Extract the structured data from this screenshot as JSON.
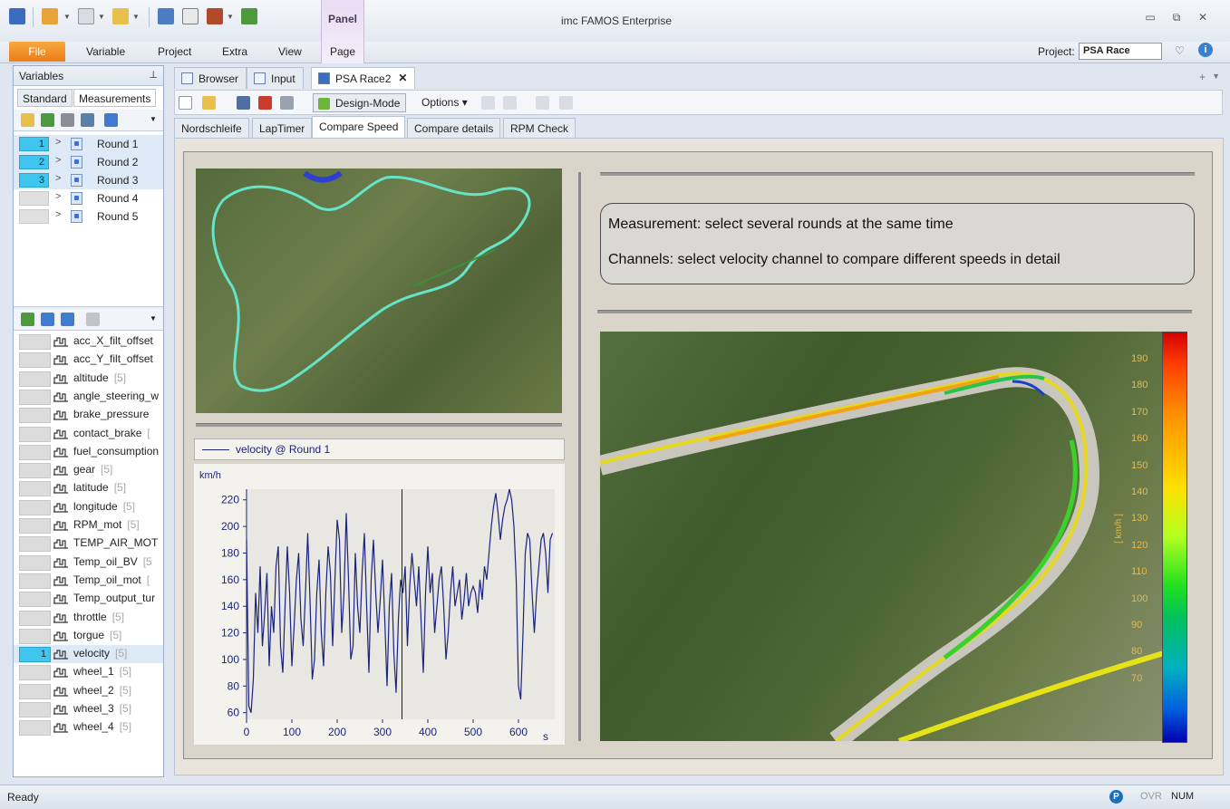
{
  "window": {
    "title": "imc FAMOS Enterprise",
    "context_tab": "Panel"
  },
  "menu": {
    "file": "File",
    "items": [
      "Variable",
      "Project",
      "Extra",
      "View",
      "Page"
    ]
  },
  "project": {
    "label": "Project:",
    "value": "PSA Race"
  },
  "left_pane": {
    "title": "Variables",
    "tabs": [
      "Standard",
      "Measurements"
    ],
    "active_tab": "Measurements",
    "rounds": [
      {
        "index": "1",
        "label": "Round 1",
        "selected": true
      },
      {
        "index": "2",
        "label": "Round 2",
        "selected": true
      },
      {
        "index": "3",
        "label": "Round 3",
        "selected": true
      },
      {
        "index": "",
        "label": "Round 4",
        "selected": false
      },
      {
        "index": "",
        "label": "Round 5",
        "selected": false
      }
    ],
    "channels": [
      {
        "index": "",
        "name": "acc_X_filt_offset",
        "count": ""
      },
      {
        "index": "",
        "name": "acc_Y_filt_offset",
        "count": ""
      },
      {
        "index": "",
        "name": "altitude",
        "count": "[5]"
      },
      {
        "index": "",
        "name": "angle_steering_w",
        "count": ""
      },
      {
        "index": "",
        "name": "brake_pressure",
        "count": ""
      },
      {
        "index": "",
        "name": "contact_brake",
        "count": "["
      },
      {
        "index": "",
        "name": "fuel_consumption",
        "count": ""
      },
      {
        "index": "",
        "name": "gear",
        "count": "[5]"
      },
      {
        "index": "",
        "name": "latitude",
        "count": "[5]"
      },
      {
        "index": "",
        "name": "longitude",
        "count": "[5]"
      },
      {
        "index": "",
        "name": "RPM_mot",
        "count": "[5]"
      },
      {
        "index": "",
        "name": "TEMP_AIR_MOT",
        "count": ""
      },
      {
        "index": "",
        "name": "Temp_oil_BV",
        "count": "[5"
      },
      {
        "index": "",
        "name": "Temp_oil_mot",
        "count": "["
      },
      {
        "index": "",
        "name": "Temp_output_tur",
        "count": ""
      },
      {
        "index": "",
        "name": "throttle",
        "count": "[5]"
      },
      {
        "index": "",
        "name": "torgue",
        "count": "[5]"
      },
      {
        "index": "1",
        "name": "velocity",
        "count": "[5]"
      },
      {
        "index": "",
        "name": "wheel_1",
        "count": "[5]"
      },
      {
        "index": "",
        "name": "wheel_2",
        "count": "[5]"
      },
      {
        "index": "",
        "name": "wheel_3",
        "count": "[5]"
      },
      {
        "index": "",
        "name": "wheel_4",
        "count": "[5]"
      }
    ]
  },
  "doc_tabs": [
    "Browser",
    "Input",
    "PSA Race2"
  ],
  "doc_active": "PSA Race2",
  "toolbar": {
    "design_mode": "Design-Mode",
    "options": "Options"
  },
  "page_tabs": [
    "Nordschleife",
    "LapTimer",
    "Compare Speed",
    "Compare details",
    "RPM Check"
  ],
  "page_active": "Compare Speed",
  "info": {
    "line1": "Measurement: select several rounds at the same time",
    "line2": "Channels: select velocity channel to compare different speeds in detail"
  },
  "chart_data": {
    "type": "line",
    "legend": "velocity @ Round 1",
    "ylabel": "km/h",
    "xlabel": "s",
    "xlim": [
      0,
      680
    ],
    "ylim": [
      55,
      228
    ],
    "xticks": [
      0,
      100,
      200,
      300,
      400,
      500,
      600
    ],
    "yticks": [
      60,
      80,
      100,
      120,
      140,
      160,
      180,
      200,
      220
    ],
    "cursor_x": 343,
    "series": [
      {
        "name": "velocity @ Round 1",
        "x": [
          0,
          5,
          10,
          15,
          20,
          25,
          30,
          35,
          40,
          45,
          50,
          55,
          60,
          65,
          70,
          75,
          80,
          85,
          90,
          95,
          100,
          105,
          110,
          115,
          120,
          125,
          130,
          135,
          140,
          145,
          150,
          155,
          160,
          165,
          170,
          175,
          180,
          185,
          190,
          195,
          200,
          205,
          210,
          215,
          220,
          225,
          230,
          235,
          240,
          245,
          250,
          255,
          260,
          265,
          270,
          275,
          280,
          285,
          290,
          295,
          300,
          305,
          310,
          315,
          320,
          325,
          330,
          335,
          340,
          345,
          350,
          355,
          360,
          365,
          370,
          375,
          380,
          385,
          390,
          395,
          400,
          405,
          410,
          415,
          420,
          425,
          430,
          435,
          440,
          445,
          450,
          455,
          460,
          465,
          470,
          475,
          480,
          485,
          490,
          495,
          500,
          505,
          510,
          515,
          520,
          525,
          530,
          535,
          540,
          545,
          550,
          555,
          560,
          565,
          570,
          575,
          580,
          585,
          590,
          595,
          600,
          605,
          610,
          615,
          620,
          625,
          630,
          635,
          640,
          645,
          650,
          655,
          660,
          665,
          670,
          675
        ],
        "values": [
          190,
          65,
          60,
          85,
          150,
          120,
          170,
          110,
          135,
          165,
          95,
          140,
          120,
          170,
          185,
          110,
          90,
          140,
          185,
          150,
          95,
          125,
          160,
          180,
          130,
          110,
          150,
          195,
          145,
          85,
          100,
          150,
          175,
          120,
          95,
          150,
          185,
          165,
          110,
          160,
          205,
          190,
          120,
          150,
          210,
          160,
          100,
          110,
          180,
          140,
          120,
          165,
          195,
          140,
          90,
          160,
          190,
          150,
          120,
          145,
          175,
          130,
          80,
          140,
          165,
          105,
          75,
          130,
          160,
          150,
          170,
          110,
          155,
          180,
          160,
          140,
          170,
          130,
          90,
          150,
          185,
          150,
          165,
          120,
          140,
          160,
          170,
          140,
          100,
          120,
          150,
          170,
          140,
          150,
          160,
          130,
          145,
          165,
          140,
          150,
          155,
          150,
          135,
          160,
          145,
          170,
          160,
          180,
          200,
          215,
          225,
          210,
          190,
          205,
          215,
          220,
          228,
          220,
          200,
          160,
          80,
          70,
          120,
          180,
          195,
          190,
          150,
          120,
          150,
          170,
          190,
          195,
          180,
          150,
          190,
          195
        ]
      }
    ]
  },
  "colorbar": {
    "unit": "[ km/h ]",
    "ticks": [
      190,
      180,
      170,
      160,
      150,
      140,
      130,
      120,
      110,
      100,
      90,
      80,
      70
    ]
  },
  "status": {
    "ready": "Ready",
    "ovr": "OVR",
    "num": "NUM"
  }
}
